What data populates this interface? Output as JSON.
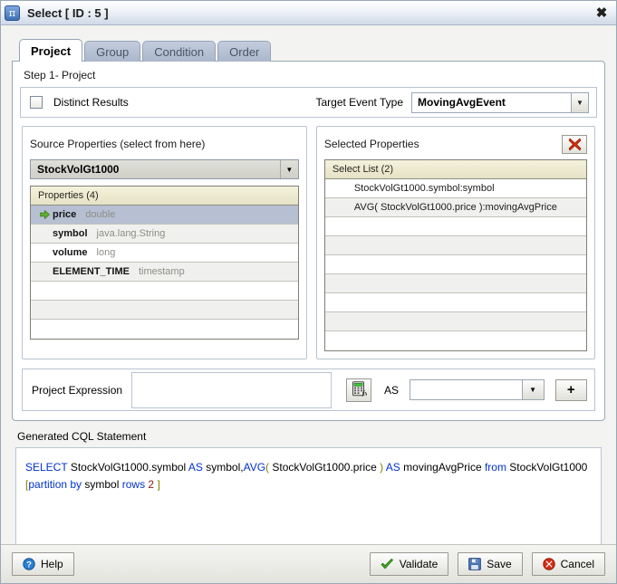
{
  "window": {
    "title": "Select [ ID : 5 ]",
    "icon": "pi-projection-icon",
    "close_label": "✖"
  },
  "tabs": [
    {
      "label": "Project",
      "active": true
    },
    {
      "label": "Group",
      "active": false
    },
    {
      "label": "Condition",
      "active": false
    },
    {
      "label": "Order",
      "active": false
    }
  ],
  "step": {
    "label": "Step 1- Project"
  },
  "options": {
    "distinct_label": "Distinct Results",
    "distinct_checked": false,
    "target_event_type_label": "Target Event Type",
    "target_event_type_value": "MovingAvgEvent"
  },
  "source": {
    "panel_title": "Source Properties (select from here)",
    "stream_value": "StockVolGt1000",
    "list_header": "Properties (4)",
    "properties": [
      {
        "name": "price",
        "type": "double",
        "selected": true
      },
      {
        "name": "symbol",
        "type": "java.lang.String",
        "selected": false
      },
      {
        "name": "volume",
        "type": "long",
        "selected": false
      },
      {
        "name": "ELEMENT_TIME",
        "type": "timestamp",
        "selected": false
      }
    ],
    "empty_rows": 3
  },
  "selected": {
    "panel_title": "Selected Properties",
    "delete_button": "remove-selected-property",
    "list_header": "Select List (2)",
    "items": [
      "StockVolGt1000.symbol:symbol",
      "AVG( StockVolGt1000.price ):movingAvgPrice"
    ],
    "empty_rows": 7
  },
  "expression": {
    "label": "Project Expression",
    "value": "",
    "builder_button": "expression-builder-icon",
    "as_label": "AS",
    "alias_value": "",
    "add_label": "+"
  },
  "cql": {
    "label": "Generated CQL Statement",
    "tokens": [
      {
        "t": "SELECT",
        "c": "kw"
      },
      {
        "t": " ",
        "c": "txt"
      },
      {
        "t": "StockVolGt1000.symbol",
        "c": "txt"
      },
      {
        "t": " ",
        "c": "txt"
      },
      {
        "t": "AS",
        "c": "kw"
      },
      {
        "t": " symbol,",
        "c": "txt"
      },
      {
        "t": "AVG",
        "c": "kw"
      },
      {
        "t": "(",
        "c": "brk"
      },
      {
        "t": " StockVolGt1000.price ",
        "c": "txt"
      },
      {
        "t": ")",
        "c": "brk"
      },
      {
        "t": " ",
        "c": "txt"
      },
      {
        "t": "AS",
        "c": "kw"
      },
      {
        "t": " movingAvgPrice ",
        "c": "txt"
      },
      {
        "t": "from",
        "c": "kw"
      },
      {
        "t": "  StockVolGt1000",
        "c": "txt"
      },
      {
        "t": "\n",
        "c": "txt"
      },
      {
        "t": "[",
        "c": "brk"
      },
      {
        "t": "partition by",
        "c": "kw"
      },
      {
        "t": "  symbol  ",
        "c": "txt"
      },
      {
        "t": "rows",
        "c": "kw"
      },
      {
        "t": " ",
        "c": "txt"
      },
      {
        "t": "2",
        "c": "num"
      },
      {
        "t": " ",
        "c": "txt"
      },
      {
        "t": "]",
        "c": "brk"
      }
    ],
    "plain_text": "SELECT StockVolGt1000.symbol AS symbol,AVG( StockVolGt1000.price ) AS movingAvgPrice from  StockVolGt1000 [partition by  symbol  rows 2 ]"
  },
  "footer": {
    "help_label": "Help",
    "validate_label": "Validate",
    "save_label": "Save",
    "cancel_label": "Cancel"
  },
  "colors": {
    "keyword": "#0033cc",
    "bracket": "#7d7d00",
    "number": "#8b1a1a",
    "selection": "#b7c0d2",
    "list_header": "#e6e2c6",
    "accent_red": "#cc2200",
    "accent_green": "#3a9c20"
  }
}
